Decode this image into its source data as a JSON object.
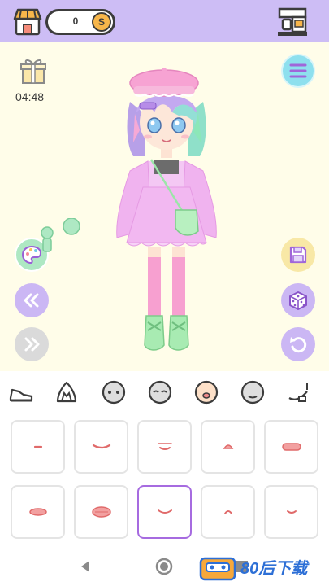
{
  "header": {
    "coins": "0",
    "coin_symbol": "S"
  },
  "timer": "04:48",
  "icons": {
    "shop": "shop-icon",
    "coffee_machine": "coffee-machine-icon",
    "gift": "gift-icon",
    "menu": "menu-icon",
    "palette": "palette-icon",
    "previous": "double-chevron-left-icon",
    "next": "double-chevron-right-icon",
    "save": "floppy-disk-icon",
    "random": "dice-icon",
    "undo": "undo-icon"
  },
  "category_tabs": [
    "shoes",
    "hair",
    "face",
    "eyes",
    "mouth",
    "skin",
    "accessory"
  ],
  "selected_tab": "mouth",
  "mouth_options": {
    "count": 10,
    "selected_index": 7
  },
  "watermark": {
    "text": "80后下载"
  },
  "colors": {
    "topbar": "#cdbdf5",
    "background": "#fffde9",
    "accent_purple": "#cbb7f4",
    "selected_border": "#a66be0",
    "mouth_pink": "#f08a8a"
  }
}
